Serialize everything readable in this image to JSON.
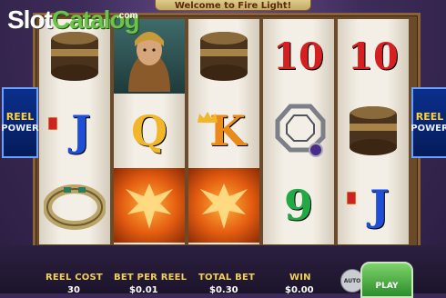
{
  "banner": {
    "text": "Welcome to Fire Light!"
  },
  "watermark": {
    "slot": "Slot",
    "catalog": "Catalog",
    "com": ".com"
  },
  "reel_power": {
    "line1": "REEL",
    "line2": "POWER"
  },
  "reels": [
    [
      "drum",
      "J",
      "bracelet"
    ],
    [
      "goddess",
      "Q",
      "phoenix"
    ],
    [
      "drum",
      "K",
      "phoenix"
    ],
    [
      "10",
      "amulet",
      "9"
    ],
    [
      "10",
      "drum",
      "J"
    ]
  ],
  "meters": {
    "reel_cost": {
      "label": "REEL COST",
      "value": "30"
    },
    "bet_per_reel": {
      "label": "BET PER REEL",
      "value": "$0.01"
    },
    "total_bet": {
      "label": "TOTAL BET",
      "value": "$0.30"
    },
    "win": {
      "label": "WIN",
      "value": "$0.00"
    }
  },
  "controls": {
    "auto_label": "AUTO",
    "play_label": "PLAY"
  },
  "colors": {
    "card_blue": "#1e4fd6",
    "card_red": "#d42020",
    "card_green": "#22a844",
    "card_gold": "#f1b62a"
  }
}
